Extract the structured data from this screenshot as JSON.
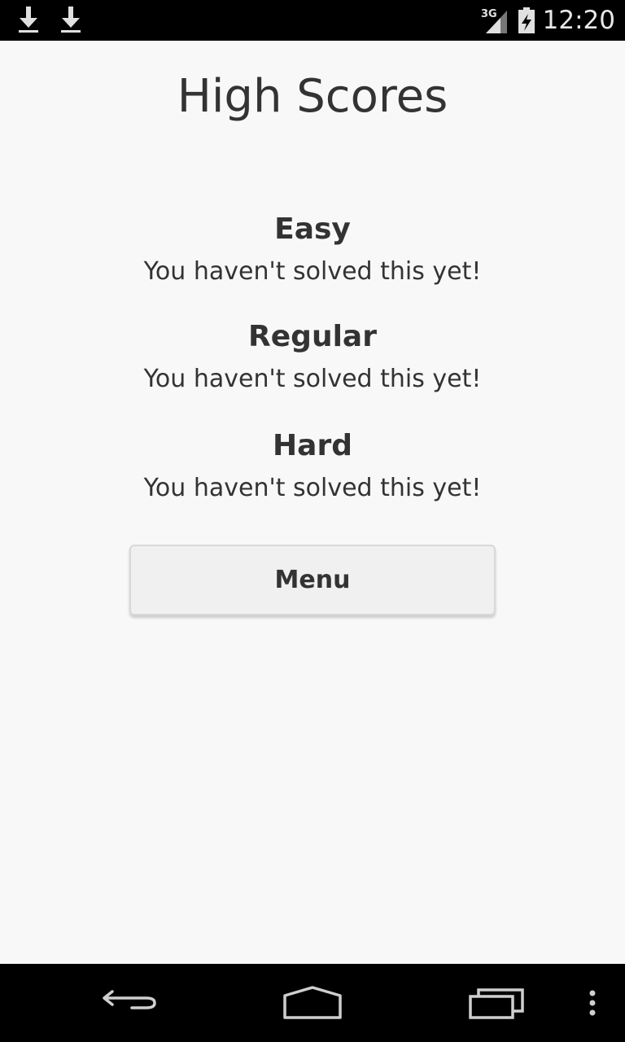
{
  "status_bar": {
    "time": "12:20",
    "network": "3G",
    "icons": [
      "download-icon",
      "download-icon",
      "signal-icon",
      "battery-icon"
    ]
  },
  "page": {
    "title": "High Scores"
  },
  "scores": [
    {
      "level": "Easy",
      "status": "You haven't solved this yet!"
    },
    {
      "level": "Regular",
      "status": "You haven't solved this yet!"
    },
    {
      "level": "Hard",
      "status": "You haven't solved this yet!"
    }
  ],
  "menu_button": {
    "label": "Menu"
  },
  "nav_bar": {
    "icons": [
      "back-icon",
      "home-icon",
      "recent-apps-icon",
      "overflow-menu-icon"
    ]
  },
  "colors": {
    "background": "#f8f8f8",
    "text": "#333333",
    "bar": "#000000",
    "button": "#f0f0f0"
  }
}
